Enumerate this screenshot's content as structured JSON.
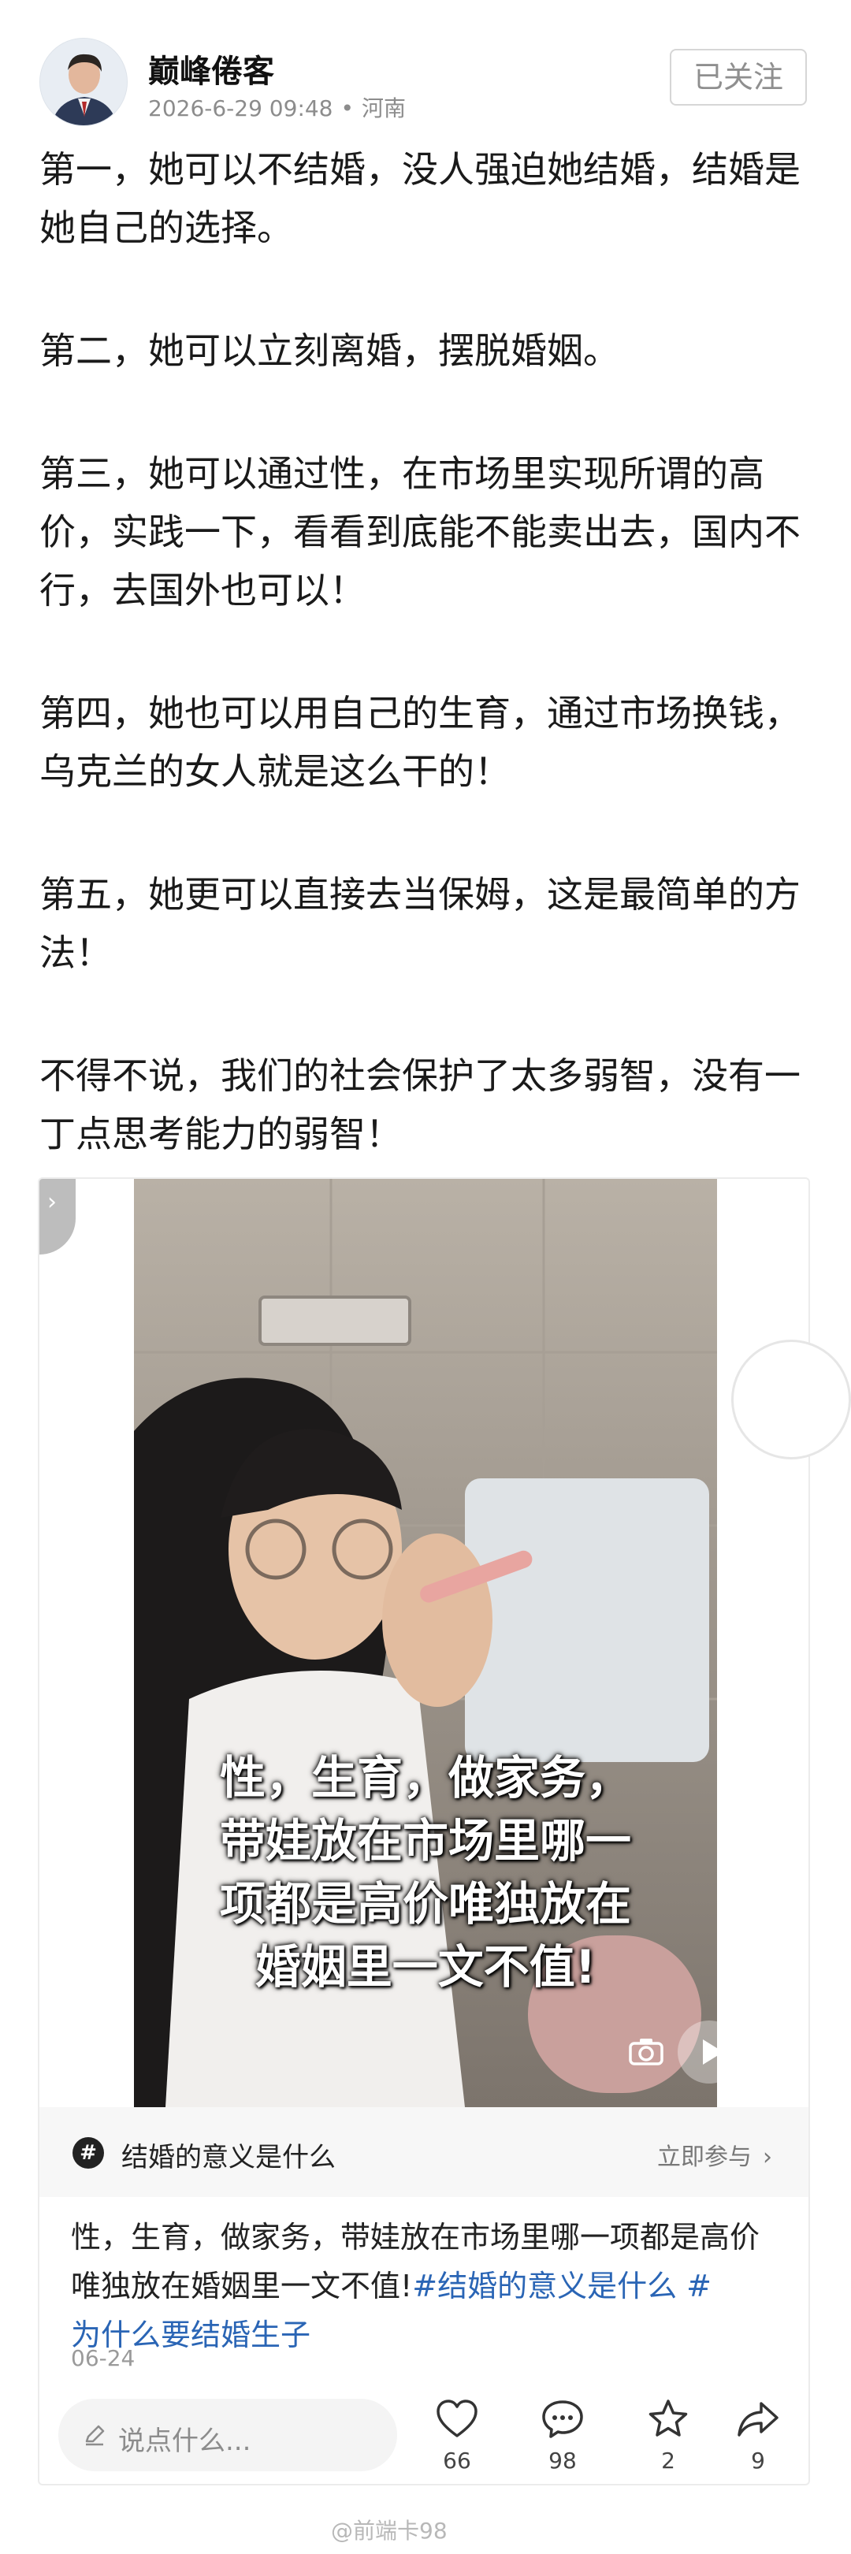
{
  "author": {
    "name": "巅峰倦客",
    "time": "2026-6-29 09:48",
    "location": "河南",
    "follow_label": "已关注"
  },
  "post": {
    "paragraphs": [
      "第一，她可以不结婚，没人强迫她结婚，结婚是她自己的选择。",
      "第二，她可以立刻离婚，摆脱婚姻。",
      "第三，她可以通过性，在市场里实现所谓的高价，实践一下，看看到底能不能卖出去，国内不行，去国外也可以！",
      "第四，她也可以用自己的生育，通过市场换钱，乌克兰的女人就是这么干的！",
      "第五，她更可以直接去当保姆，这是最简单的方法！",
      "不得不说，我们的社会保护了太多弱智，没有一丁点思考能力的弱智！"
    ]
  },
  "embedded": {
    "subtitle_lines": [
      "性，生育，做家务，",
      "带娃放在市场里哪一",
      "项都是高价唯独放在",
      "婚姻里一文不值!"
    ],
    "topic_icon": "#",
    "topic": "结婚的意义是什么",
    "topic_action": "立即参与",
    "desc_text": "性，生育，做家务，带娃放在市场里哪一项都是高价唯独放在婚姻里一文不值!",
    "desc_tag1": "#结婚的意义是什么 #",
    "desc_tag2": "为什么要结婚生子",
    "date": "06-24",
    "comment_placeholder": "说点什么...",
    "likes": "66",
    "comments": "98",
    "favorites": "2",
    "shares": "9"
  },
  "watermark": "@前端卡98",
  "colors": {
    "link": "#2a65b5",
    "muted": "#8c8c8c"
  }
}
